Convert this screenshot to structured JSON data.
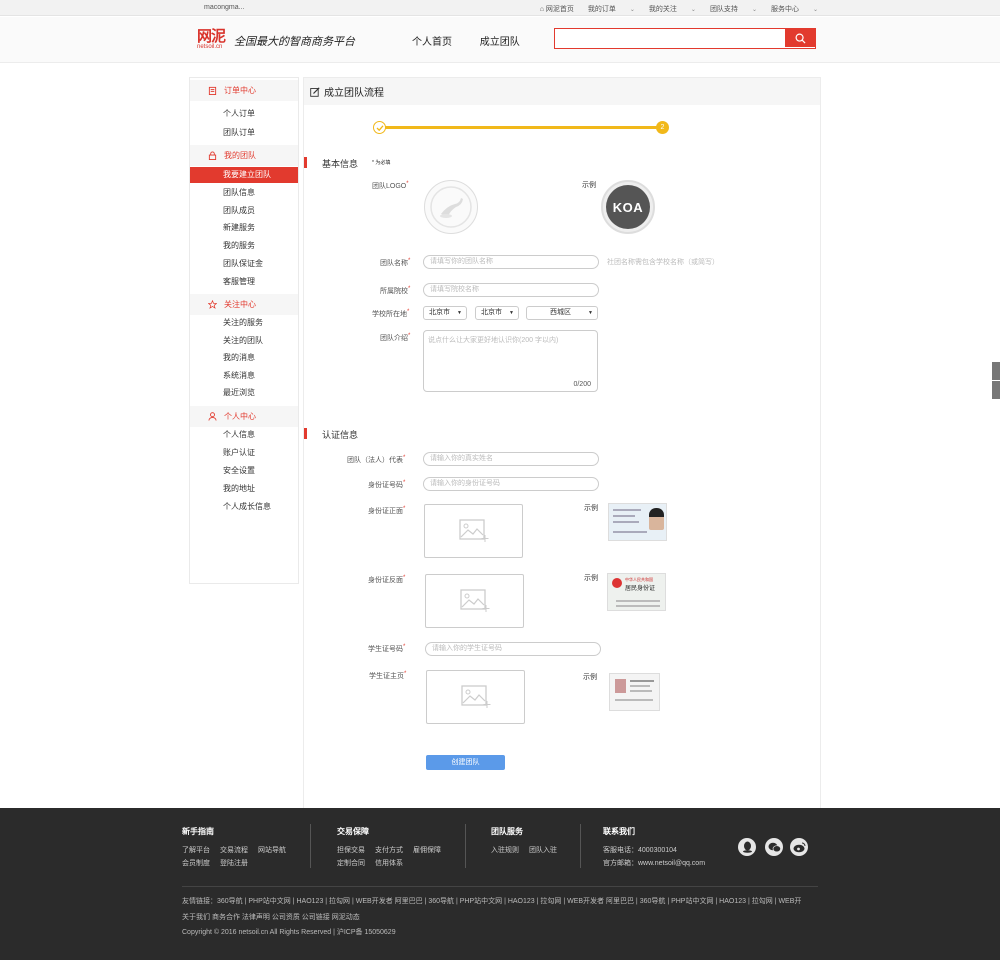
{
  "topbar": {
    "user": "macongma...",
    "links": [
      "网泥首页",
      "我的订单",
      "我的关注",
      "团队支持",
      "服务中心"
    ]
  },
  "header": {
    "logo_mark": "网泥",
    "logo_domain": "netsoil.cn",
    "slogan": "全国最大的智商商务平台",
    "nav": [
      "个人首页",
      "成立团队"
    ],
    "search_placeholder": ""
  },
  "sidebar": {
    "groups": [
      {
        "title": "订单中心",
        "items": [
          "个人订单",
          "团队订单"
        ]
      },
      {
        "title": "我的团队",
        "items": [
          "我要建立团队",
          "团队信息",
          "团队成员",
          "新建服务",
          "我的服务",
          "团队保证金",
          "客服管理"
        ]
      },
      {
        "title": "关注中心",
        "items": [
          "关注的服务",
          "关注的团队",
          "我的消息",
          "系统消息",
          "最近浏览"
        ]
      },
      {
        "title": "个人中心",
        "items": [
          "个人信息",
          "账户认证",
          "安全设置",
          "我的地址",
          "个人成长信息"
        ]
      }
    ],
    "active_item": "我要建立团队"
  },
  "main": {
    "title": "成立团队流程",
    "step2_number": "2",
    "basic": {
      "section_title": "基本信息",
      "required_note": "* 为必填",
      "logo_label": "团队LOGO",
      "example_label": "示例",
      "example_logo_text": "KOA",
      "name_label": "团队名称",
      "name_placeholder": "请填写你的团队名称",
      "name_hint": "社团名称需包含学校名称（或简写）",
      "school_label": "所属院校",
      "school_placeholder": "请填写院校名称",
      "location_label": "学校所在地",
      "location_values": [
        "北京市",
        "北京市",
        "西城区"
      ],
      "intro_label": "团队介绍",
      "intro_placeholder": "说点什么让大家更好地认识你(200 字以内)",
      "intro_count": "0/200"
    },
    "cert": {
      "section_title": "认证信息",
      "rep_label": "团队（法人）代表",
      "rep_placeholder": "请输入你的真实姓名",
      "id_label": "身份证号码",
      "id_placeholder": "请输入你的身份证号码",
      "id_front_label": "身份证正面",
      "id_back_label": "身份证反面",
      "student_no_label": "学生证号码",
      "student_no_placeholder": "请输入你的学生证号码",
      "student_card_label": "学生证主页",
      "example_label": "示例",
      "back_card_title": "中华人民共和国",
      "back_card_sub": "居民身份证"
    },
    "submit_label": "创建团队"
  },
  "footer": {
    "cols": [
      {
        "title": "新手指南",
        "rows": [
          [
            "了解平台",
            "交易流程",
            "网站导航"
          ],
          [
            "会员制度",
            "登陆注册"
          ]
        ]
      },
      {
        "title": "交易保障",
        "rows": [
          [
            "担保交易",
            "支付方式",
            "雇佣保障"
          ],
          [
            "定制合同",
            "信用体系"
          ]
        ]
      },
      {
        "title": "团队服务",
        "rows": [
          [
            "入驻规则",
            "团队入驻"
          ]
        ]
      },
      {
        "title": "联系我们",
        "rows": [
          [
            "客服电话：4000300104"
          ],
          [
            "官方邮箱：www.netsoil@qq.com"
          ]
        ]
      }
    ],
    "friend_links": "友情链接：360导航 | PHP站中文网 | HAO123 | 拉勾网 | WEB开发者  阿里巴巴  | 360导航 | PHP站中文网 | HAO123 | 拉勾网 | WEB开发者  阿里巴巴  | 360导航 | PHP站中文网 | HAO123 | 拉勾网 | WEB开",
    "about_links": "关于我们   商务合作   法律声明   公司资质   公司链接   网泥动态",
    "copyright": "Copyright © 2016 netsoil.cn All Rights Reserved | 沪ICP备 15050629"
  }
}
